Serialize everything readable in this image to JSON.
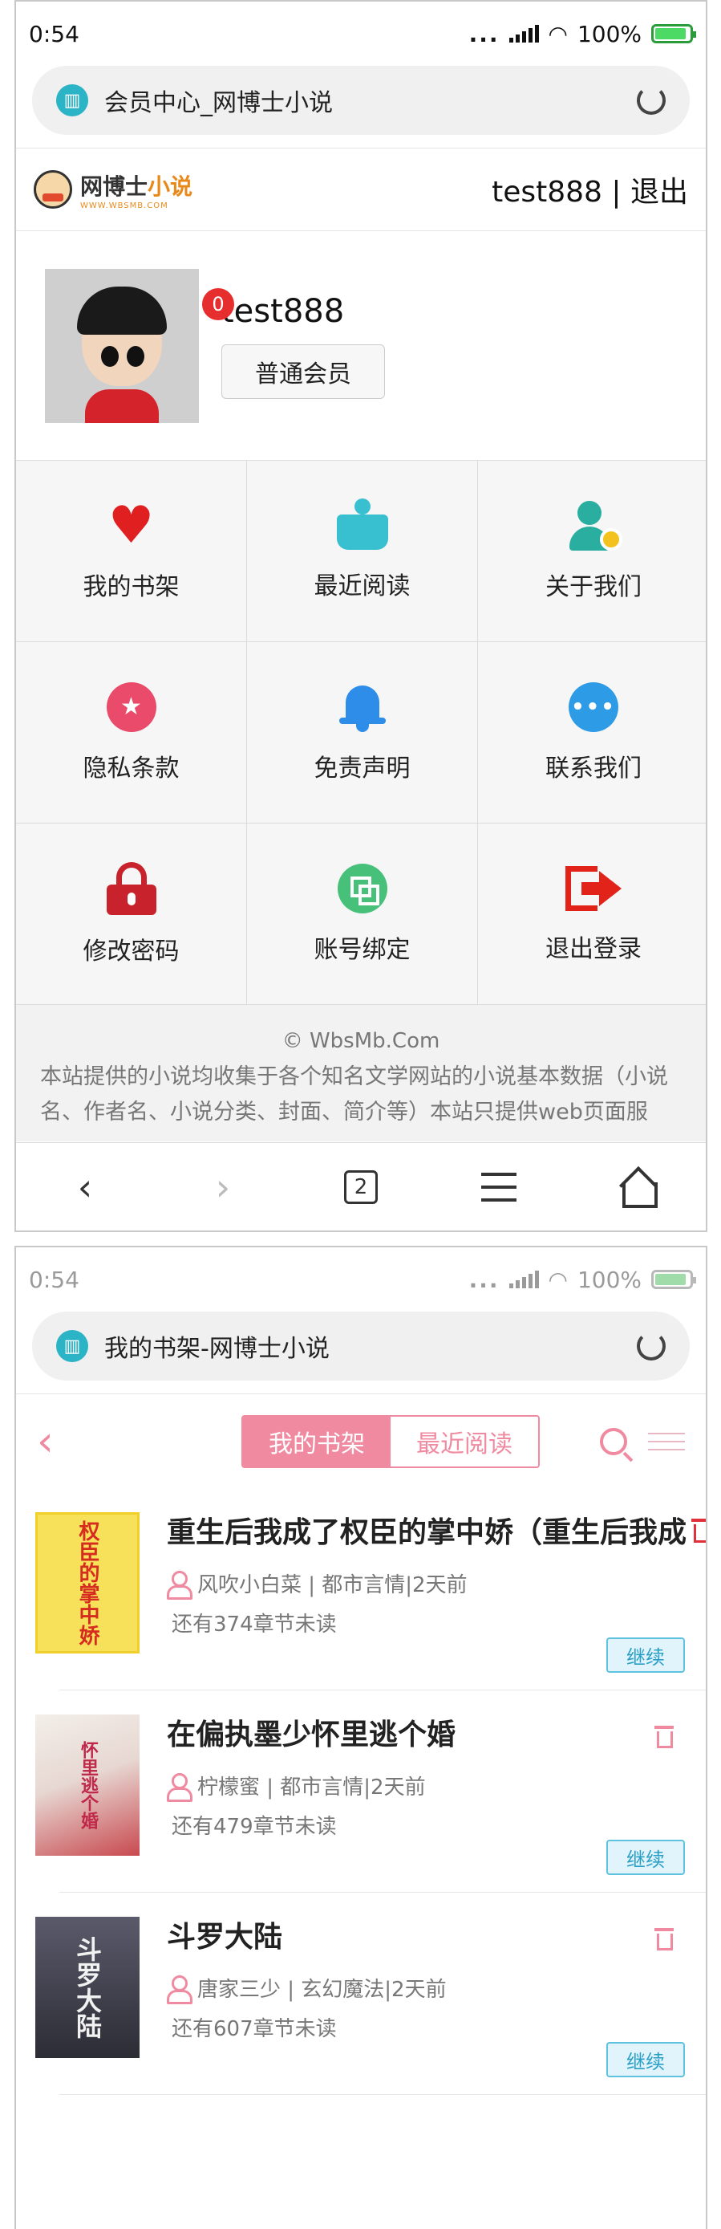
{
  "screen1": {
    "status": {
      "time": "0:54",
      "dots": "...",
      "battery_percent": "100%"
    },
    "urlbar": {
      "title": "会员中心_网博士小说",
      "icon": "book-icon"
    },
    "header": {
      "logo_main": "网博士",
      "logo_accent": "小说",
      "logo_sub": "WWW.WBSMB.COM",
      "username": "test888",
      "separator": " | ",
      "logout_label": "退出"
    },
    "profile": {
      "message_count": "0",
      "username": "test888",
      "level": "普通会员"
    },
    "menu": [
      {
        "label": "我的书架",
        "icon": "heart-icon"
      },
      {
        "label": "最近阅读",
        "icon": "open-book-icon"
      },
      {
        "label": "关于我们",
        "icon": "user-gear-icon"
      },
      {
        "label": "隐私条款",
        "icon": "star-badge-icon"
      },
      {
        "label": "免责声明",
        "icon": "bell-icon"
      },
      {
        "label": "联系我们",
        "icon": "chat-bubble-icon"
      },
      {
        "label": "修改密码",
        "icon": "lock-icon"
      },
      {
        "label": "账号绑定",
        "icon": "link-squares-icon"
      },
      {
        "label": "退出登录",
        "icon": "logout-icon"
      }
    ],
    "footer": {
      "copyright": "© WbsMb.Com",
      "text": "本站提供的小说均收集于各个知名文学网站的小说基本数据（小说名、作者名、小说分类、封面、简介等）本站只提供web页面服"
    },
    "navbar": {
      "tab_count": "2"
    }
  },
  "screen2": {
    "status": {
      "time": "0:54",
      "dots": "...",
      "battery_percent": "100%"
    },
    "urlbar": {
      "title": "我的书架-网博士小说",
      "icon": "book-icon"
    },
    "tabs": [
      {
        "label": "我的书架",
        "active": true
      },
      {
        "label": "最近阅读",
        "active": false
      }
    ],
    "books": [
      {
        "title": "重生后我成了权臣的掌中娇（重生后我成",
        "cover_text": "权臣的掌中娇",
        "meta": "风吹小白菜 | 都市言情|2天前",
        "unread": "还有374章节未读",
        "action": "继续"
      },
      {
        "title": "在偏执墨少怀里逃个婚",
        "cover_text": "怀里逃个婚",
        "meta": "柠檬蜜 | 都市言情|2天前",
        "unread": "还有479章节未读",
        "action": "继续"
      },
      {
        "title": "斗罗大陆",
        "cover_text": "斗罗大陆",
        "meta": "唐家三少 | 玄幻魔法|2天前",
        "unread": "还有607章节未读",
        "action": "继续"
      }
    ]
  },
  "colors": {
    "accent_pink": "#f08aa0",
    "continue_blue": "#2a9fc6",
    "badge_red": "#e62e2e"
  }
}
